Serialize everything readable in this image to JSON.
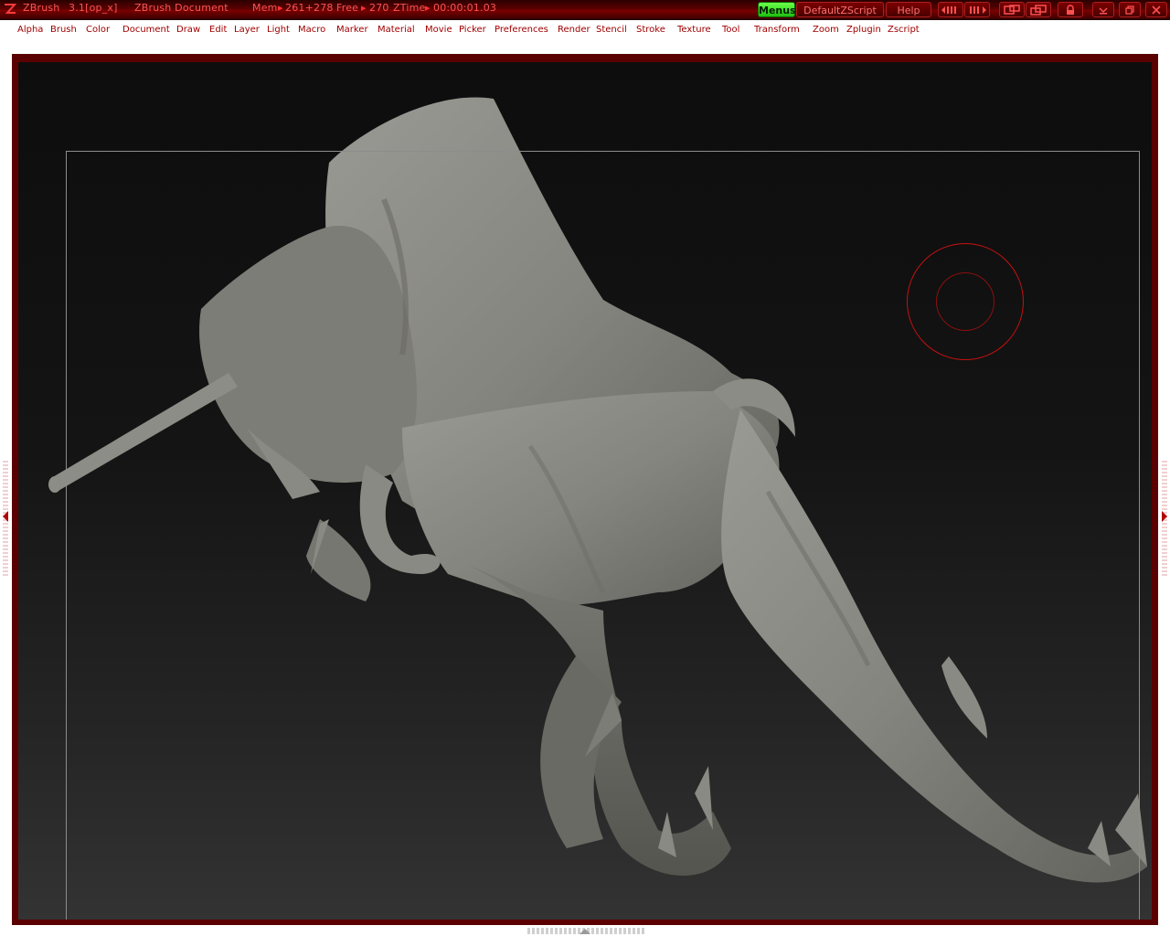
{
  "titlebar": {
    "app_name": "ZBrush",
    "version": "3.1[op_x]",
    "document_name": "ZBrush Document",
    "mem_label": "Mem",
    "mem_value": "261+278",
    "free_label": "Free",
    "free_value": "270",
    "ztime_label": "ZTime",
    "ztime_value": "00:00:01.03",
    "menus_label": "Menus",
    "script_label": "DefaultZScript",
    "help_label": "Help"
  },
  "menubar": {
    "items": [
      "Alpha",
      "Brush",
      "Color",
      "Document",
      "Draw",
      "Edit",
      "Layer",
      "Light",
      "Macro",
      "Marker",
      "Material",
      "Movie",
      "Picker",
      "Preferences",
      "Render",
      "Stencil",
      "Stroke",
      "Texture",
      "Tool",
      "Transform",
      "Zoom",
      "Zplugin",
      "Zscript"
    ]
  },
  "icons": {
    "logo": "zbrush-logo-icon",
    "rewind": "scroll-left-icon",
    "forward": "scroll-right-icon",
    "layout_a": "layout-icon",
    "layout_b": "layout-alt-icon",
    "lock": "lock-icon",
    "minimize": "minimize-icon",
    "restore": "restore-icon",
    "close": "close-icon"
  },
  "colors": {
    "accent": "#ff3333",
    "title_bar": "#5a0000",
    "menus_button": "#3fdc20",
    "canvas_top": "#0d0d0d",
    "canvas_bottom": "#333333",
    "model": "#8a8a84",
    "draw_cursor": "#c81010"
  }
}
